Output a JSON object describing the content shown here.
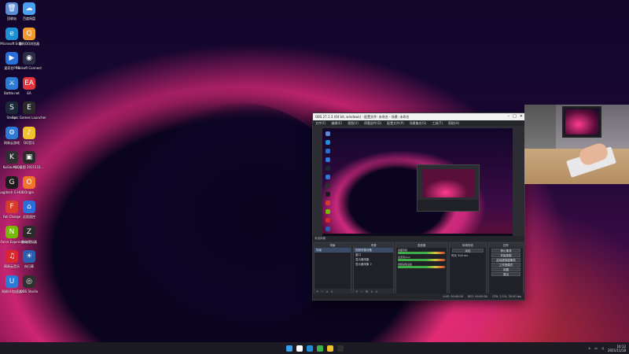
{
  "desktop_icons": [
    {
      "label": "回收站",
      "color": "#5a8cd6",
      "glyph": "🗑"
    },
    {
      "label": "百度网盘",
      "color": "#4a9ff0",
      "glyph": "☁"
    },
    {
      "label": "Microsoft Edge",
      "color": "#1e8fd6",
      "glyph": "e"
    },
    {
      "label": "腾讯QQ浏览器",
      "color": "#f29a2e",
      "glyph": "Q"
    },
    {
      "label": "爱奇艺PPS",
      "color": "#2a6fd8",
      "glyph": "▶"
    },
    {
      "label": "Ubisoft Connect",
      "color": "#2a2f45",
      "glyph": "◉"
    },
    {
      "label": "Battle.net",
      "color": "#2b7bd6",
      "glyph": "⚔"
    },
    {
      "label": "EA",
      "color": "#e2343c",
      "glyph": "EA"
    },
    {
      "label": "Steam",
      "color": "#1b2838",
      "glyph": "S"
    },
    {
      "label": "Epic Games Launcher",
      "color": "#2a2a2a",
      "glyph": "E"
    },
    {
      "label": "网易云游戏",
      "color": "#2a7ad6",
      "glyph": "⚙"
    },
    {
      "label": "QQ音乐",
      "color": "#f0c22e",
      "glyph": "♪"
    },
    {
      "label": "KuGouMu...",
      "color": "#2f2f2f",
      "glyph": "K"
    },
    {
      "label": "QQ截图 2021111...",
      "color": "#2a2a2a",
      "glyph": "▣"
    },
    {
      "label": "Logitech G HUB",
      "color": "#1c1c1c",
      "glyph": "G"
    },
    {
      "label": "Origin",
      "color": "#f0742e",
      "glyph": "O"
    },
    {
      "label": "Fall Charge",
      "color": "#d63c2a",
      "glyph": "F"
    },
    {
      "label": "远程遥控",
      "color": "#2a6fd8",
      "glyph": "⌂"
    },
    {
      "label": "GeForce Experience",
      "color": "#76b900",
      "glyph": "N"
    },
    {
      "label": "雷电模拟器",
      "color": "#2a2a2a",
      "glyph": "Z"
    },
    {
      "label": "网易云音乐",
      "color": "#d8282e",
      "glyph": "♫"
    },
    {
      "label": "向日葵",
      "color": "#2a5fb0",
      "glyph": "☀"
    },
    {
      "label": "网易UU加速器",
      "color": "#2a7ad6",
      "glyph": "U"
    },
    {
      "label": "OBS Studio",
      "color": "#303030",
      "glyph": "◎"
    }
  ],
  "obs": {
    "title": "OBS 27.1.3 (64 bit, windows) - 配置文件: 未命名 - 场景: 未命名",
    "menu": [
      "文件(F)",
      "编辑(E)",
      "视图(V)",
      "停靠部件(D)",
      "配置文件(P)",
      "场景集合(S)",
      "工具(T)",
      "帮助(H)"
    ],
    "scene_bar_label": "未选择源",
    "docks": {
      "scenes": {
        "title": "场景",
        "items": [
          "场景"
        ]
      },
      "sources": {
        "title": "来源",
        "items": [
          "视频采集设备",
          "窗口",
          "显示器采集",
          "显示器采集 2"
        ]
      },
      "mixer": {
        "title": "混音器",
        "channels": [
          "桌面音频",
          "麦克风/Aux",
          "视频采集设备"
        ]
      },
      "transitions": {
        "title": "转场特效",
        "type": "淡出",
        "duration_label": "时长",
        "duration": "300 ms"
      },
      "controls": {
        "title": "控件",
        "buttons": [
          "停止推流",
          "开始录制",
          "启动虚拟摄像机",
          "工作室模式",
          "设置",
          "退出"
        ]
      }
    },
    "status": {
      "live": "LIVE: 00:00:00",
      "rec": "REC: 00:00:00",
      "cpu": "CPU: 2.1%, 30.00 fps"
    }
  },
  "taskbar": {
    "apps": [
      {
        "name": "windows-start",
        "color": "#3a9ff0"
      },
      {
        "name": "search",
        "color": "#ffffff"
      },
      {
        "name": "edge",
        "color": "#1e8fd6"
      },
      {
        "name": "xbox",
        "color": "#3fae49"
      },
      {
        "name": "qq-music",
        "color": "#f0c22e"
      },
      {
        "name": "obs",
        "color": "#303030"
      }
    ],
    "time": "10:12",
    "date": "2021/11/18"
  }
}
